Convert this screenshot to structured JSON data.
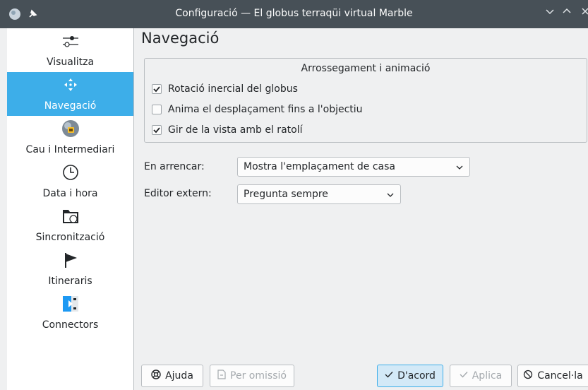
{
  "window": {
    "title": "Configuració — El globus terraqüi virtual Marble"
  },
  "sidebar": {
    "items": [
      {
        "label": "Visualitza",
        "icon": "view-sliders-icon"
      },
      {
        "label": "Navegació",
        "icon": "navigation-arrows-icon",
        "active": true
      },
      {
        "label": "Cau i Intermediari",
        "icon": "cache-globe-icon"
      },
      {
        "label": "Data i hora",
        "icon": "clock-icon"
      },
      {
        "label": "Sincronització",
        "icon": "sync-folder-icon"
      },
      {
        "label": "Itineraris",
        "icon": "flag-icon"
      },
      {
        "label": "Connectors",
        "icon": "plugin-icon"
      }
    ]
  },
  "page": {
    "title": "Navegació",
    "group": {
      "title": "Arrossegament i animació",
      "checks": [
        {
          "label": "Rotació inercial del globus",
          "checked": true
        },
        {
          "label": "Anima el desplaçament fins a l'objectiu",
          "checked": false
        },
        {
          "label": "Gir de la vista amb el ratolí",
          "checked": true
        }
      ]
    },
    "on_startup": {
      "label": "En arrencar:",
      "value": "Mostra l'emplaçament de casa"
    },
    "external_editor": {
      "label": "Editor extern:",
      "value": "Pregunta sempre"
    }
  },
  "buttons": {
    "help": "Ajuda",
    "defaults": "Per omissió",
    "ok": "D'acord",
    "apply": "Aplica",
    "cancel": "Cancel·la"
  },
  "colors": {
    "accent": "#3daee9",
    "titlebar": "#475057",
    "window_bg": "#eff0f1"
  }
}
